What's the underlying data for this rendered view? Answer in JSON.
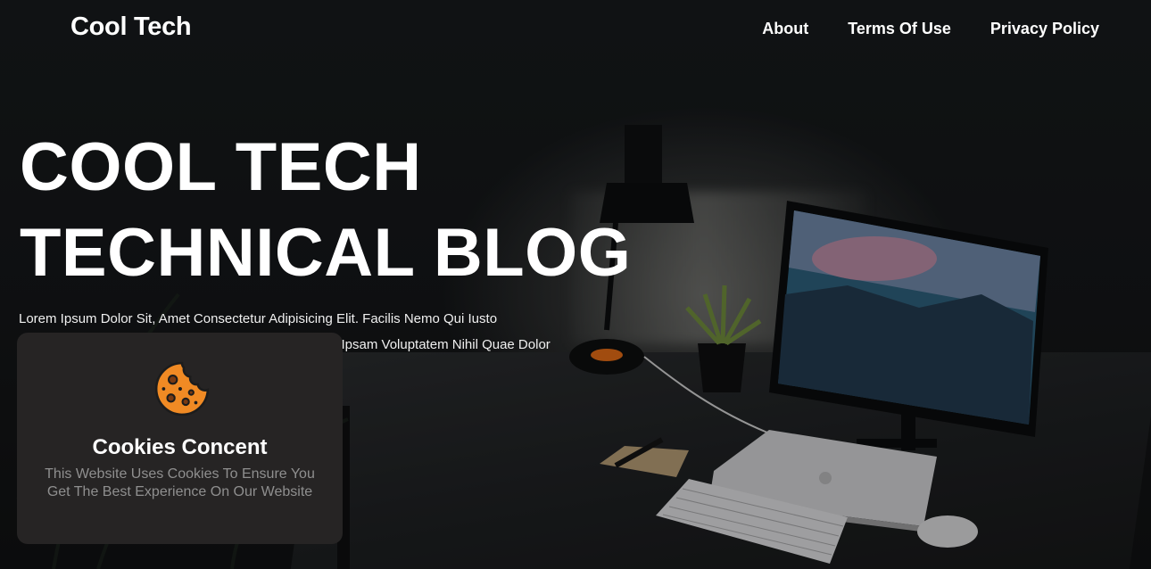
{
  "nav": {
    "brand": "Cool Tech",
    "links": [
      {
        "label": "About"
      },
      {
        "label": "Terms Of Use"
      },
      {
        "label": "Privacy Policy"
      }
    ]
  },
  "hero": {
    "headline_line1": "COOL TECH",
    "headline_line2": "TECHNICAL BLOG",
    "lead_line1": "Lorem Ipsum Dolor Sit, Amet Consectetur Adipisicing Elit. Facilis Nemo Qui Iusto",
    "lead_line2_visible": "sci Ipsam Voluptatem Nihil Quae Dolor"
  },
  "cookie_banner": {
    "icon": "cookie-icon",
    "title": "Cookies Concent",
    "text": "This Website Uses Cookies To Ensure You Get The Best Experience On Our Website"
  },
  "colors": {
    "background": "#121416",
    "card": "#262424",
    "cookie_orange": "#f08a24",
    "cookie_outline": "#1c1c1c",
    "muted_text": "#8f8f8f"
  }
}
